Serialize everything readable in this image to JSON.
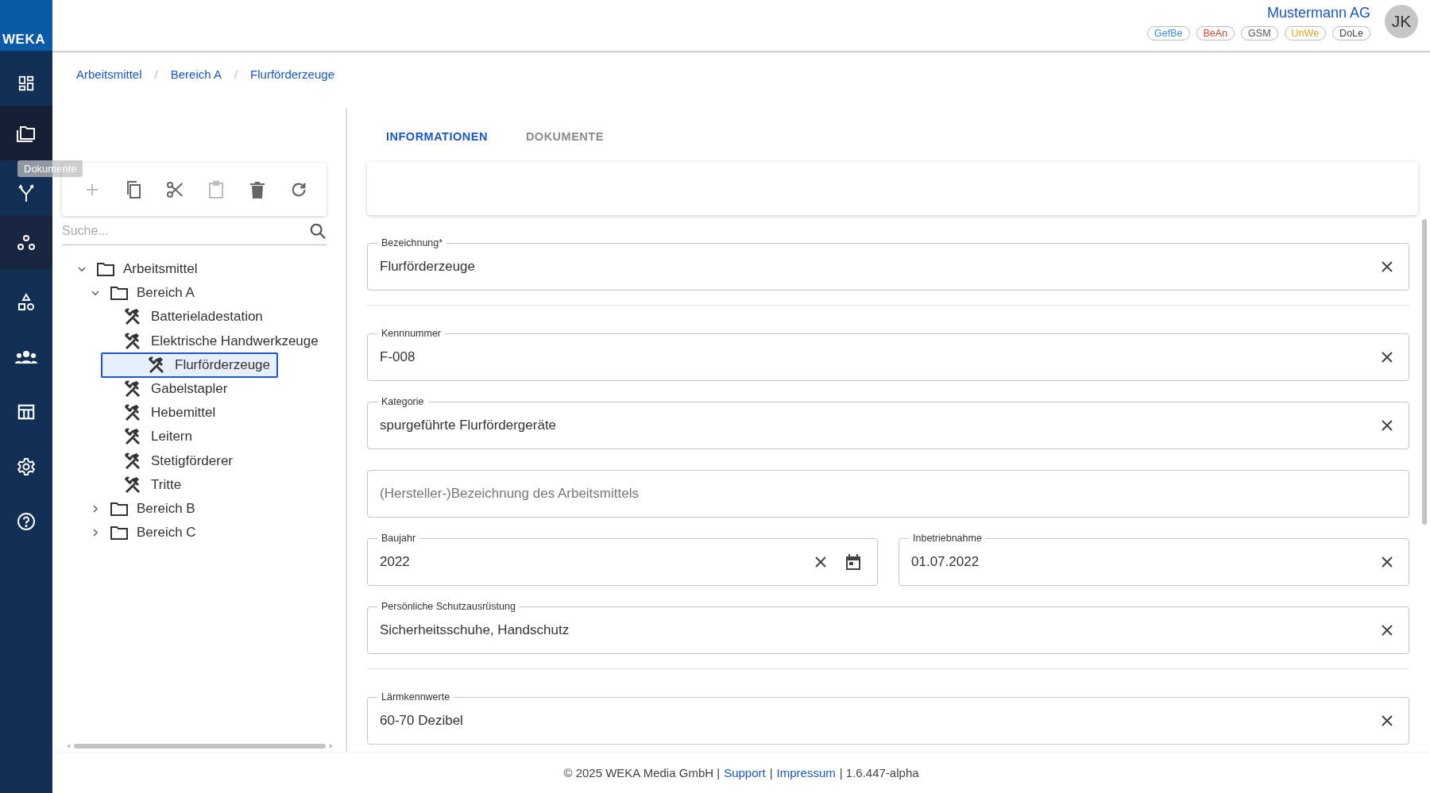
{
  "sidebar": {
    "logo": "WEKA",
    "items": [
      {
        "kind": "dashboard",
        "active": false,
        "hover": false
      },
      {
        "kind": "folders",
        "active": true,
        "hover": false
      },
      {
        "kind": "fork",
        "active": false,
        "hover": false
      },
      {
        "kind": "nodes",
        "active": false,
        "hover": true
      },
      {
        "kind": "shapes",
        "active": false,
        "hover": false
      },
      {
        "kind": "people",
        "active": false,
        "hover": false
      },
      {
        "kind": "table",
        "active": false,
        "hover": false
      },
      {
        "kind": "settings",
        "active": false,
        "hover": false
      },
      {
        "kind": "help",
        "active": false,
        "hover": false
      }
    ]
  },
  "tooltip": "Dokumente",
  "header": {
    "company": "Mustermann AG",
    "avatar": "JK",
    "badges": [
      {
        "label": "GefBe",
        "color": "#3a8fd6"
      },
      {
        "label": "BeAn",
        "color": "#d9452b"
      },
      {
        "label": "GSM",
        "color": "#555555"
      },
      {
        "label": "UnWe",
        "color": "#e9a21a"
      },
      {
        "label": "DoLe",
        "color": "#444444"
      }
    ]
  },
  "breadcrumb": [
    {
      "kind": "crumb",
      "text": "Arbeitsmittel"
    },
    {
      "kind": "separator",
      "text": "/"
    },
    {
      "kind": "crumb",
      "text": "Bereich A"
    },
    {
      "kind": "separator",
      "text": "/"
    },
    {
      "kind": "crumb",
      "text": "Flurförderzeuge"
    }
  ],
  "toolbar": [
    {
      "kind": "add",
      "disabled": true
    },
    {
      "kind": "copy",
      "disabled": false
    },
    {
      "kind": "cut",
      "disabled": false
    },
    {
      "kind": "paste",
      "disabled": true
    },
    {
      "kind": "delete",
      "disabled": false
    },
    {
      "kind": "refresh",
      "disabled": false
    }
  ],
  "search": {
    "placeholder": "Suche..."
  },
  "tree": [
    {
      "kind": "folder",
      "label": "Arbeitsmittel",
      "expanded": true,
      "selected": false,
      "children": [
        {
          "kind": "folder",
          "label": "Bereich A",
          "expanded": true,
          "selected": false,
          "children": [
            {
              "kind": "tool",
              "label": "Batterieladestation",
              "selected": false
            },
            {
              "kind": "tool",
              "label": "Elektrische Handwerkzeuge",
              "selected": false
            },
            {
              "kind": "tool",
              "label": "Flurförderzeuge",
              "selected": true
            },
            {
              "kind": "tool",
              "label": "Gabelstapler",
              "selected": false
            },
            {
              "kind": "tool",
              "label": "Hebemittel",
              "selected": false
            },
            {
              "kind": "tool",
              "label": "Leitern",
              "selected": false
            },
            {
              "kind": "tool",
              "label": "Stetigförderer",
              "selected": false
            },
            {
              "kind": "tool",
              "label": "Tritte",
              "selected": false
            }
          ]
        },
        {
          "kind": "folder",
          "label": "Bereich B",
          "expanded": false,
          "selected": false
        },
        {
          "kind": "folder",
          "label": "Bereich C",
          "expanded": false,
          "selected": false
        }
      ]
    }
  ],
  "tabs": [
    {
      "label": "INFORMATIONEN",
      "selected": true
    },
    {
      "label": "DOKUMENTE",
      "selected": false
    }
  ],
  "form": [
    {
      "kind": "field",
      "label": "Bezeichnung*",
      "value": "Flurförderzeuge",
      "clearable": true,
      "calendar": false
    },
    {
      "kind": "divider"
    },
    {
      "kind": "field",
      "label": "Kennnummer",
      "value": "F-008",
      "clearable": true,
      "calendar": false
    },
    {
      "kind": "field",
      "label": "Kategorie",
      "value": "spurgeführte Flurfördergeräte",
      "clearable": true,
      "calendar": false
    },
    {
      "kind": "field",
      "placeholder": "(Hersteller-)Bezeichnung des Arbeitsmittels",
      "clearable": false,
      "calendar": false
    },
    {
      "kind": "pair",
      "fields": [
        {
          "label": "Baujahr",
          "value": "2022",
          "clearable": true,
          "calendar": true
        },
        {
          "label": "Inbetriebnahme",
          "value": "01.07.2022",
          "clearable": true,
          "calendar": false
        }
      ]
    },
    {
      "kind": "field",
      "label": "Persönliche Schutzausrüstung",
      "value": "Sicherheitsschuhe, Handschutz",
      "clearable": true,
      "calendar": false
    },
    {
      "kind": "divider"
    },
    {
      "kind": "field",
      "label": "Lärmkennwerte",
      "value": "60-70 Dezibel",
      "clearable": true,
      "calendar": false
    }
  ],
  "footer": [
    {
      "kind": "text",
      "text": "© 2025 WEKA Media GmbH |"
    },
    {
      "kind": "link",
      "text": "Support"
    },
    {
      "kind": "text",
      "text": "|"
    },
    {
      "kind": "link",
      "text": "Impressum"
    },
    {
      "kind": "text",
      "text": "| 1.6.447-alpha"
    }
  ]
}
